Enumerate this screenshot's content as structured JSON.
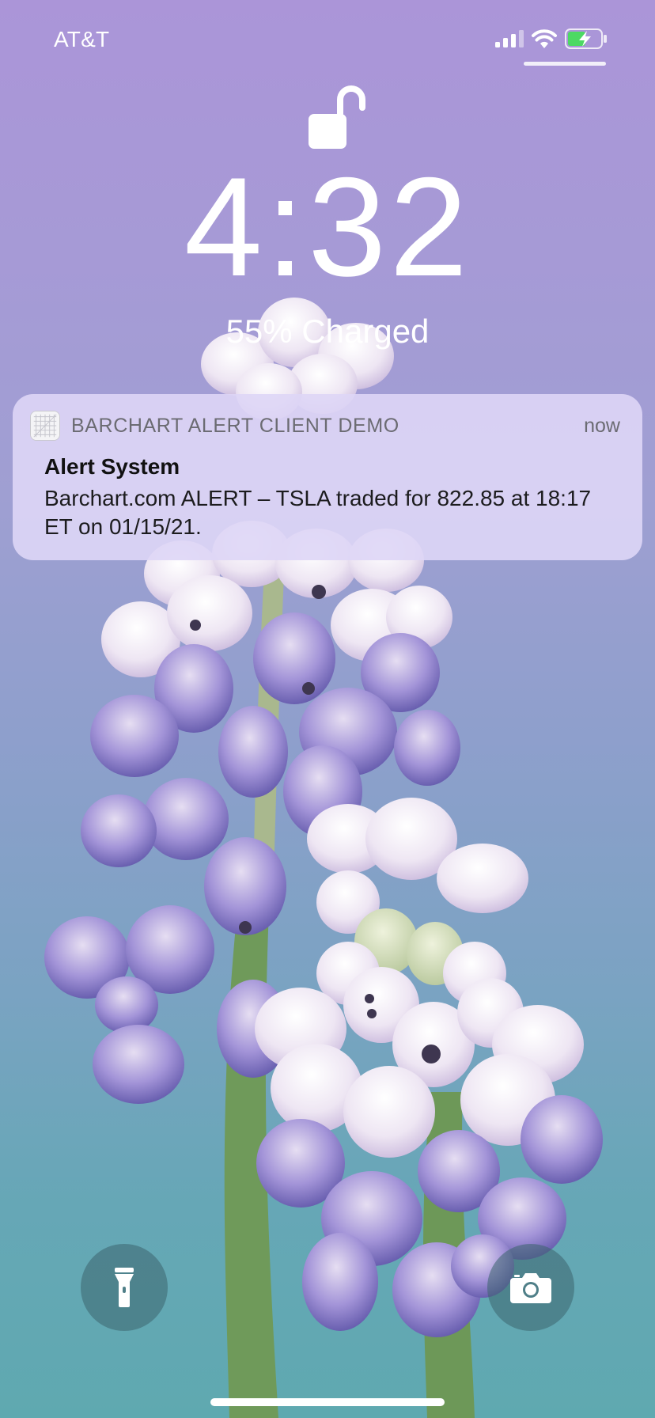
{
  "status_bar": {
    "carrier": "AT&T",
    "icons": [
      "cellular-signal-icon",
      "wifi-icon",
      "battery-charging-icon"
    ],
    "battery_level": 0.55
  },
  "lock_screen": {
    "lock_state": "unlocked",
    "time": "4:32",
    "charge_status": "55% Charged"
  },
  "notification": {
    "app_name": "BARCHART ALERT CLIENT DEMO",
    "time": "now",
    "title": "Alert System",
    "body": "Barchart.com ALERT – TSLA traded for 822.85 at 18:17 ET on 01/15/21."
  },
  "controls": {
    "left_icon": "flashlight-icon",
    "right_icon": "camera-icon"
  },
  "colors": {
    "battery_charging": "#4cd964",
    "notification_background": "#ded6f6"
  }
}
